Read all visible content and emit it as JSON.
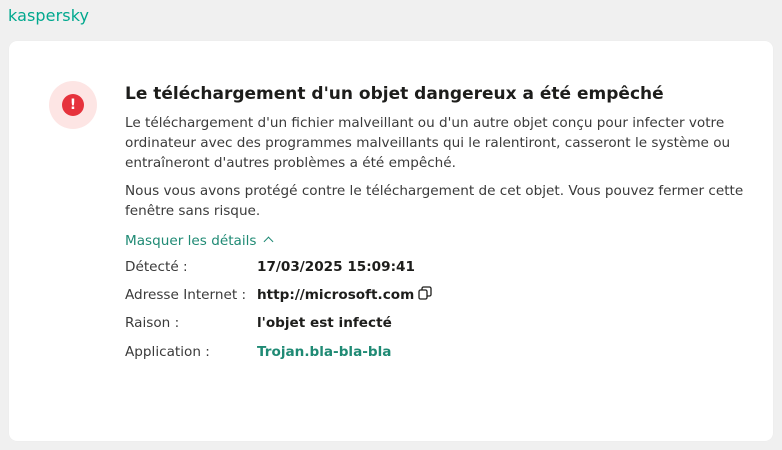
{
  "brand": {
    "logo_text": "kaspersky",
    "accent_color": "#00a88e",
    "link_color": "#1f8a74",
    "alert_color": "#e6323c"
  },
  "notification": {
    "icon": "exclamation-alert-icon",
    "icon_glyph": "!",
    "title": "Le téléchargement d'un objet dangereux a été empêché",
    "paragraph1": "Le téléchargement d'un fichier malveillant ou d'un autre objet conçu pour infecter votre ordinateur avec des programmes malveillants qui le ralentiront, casseront le système ou entraîneront d'autres problèmes a été empêché.",
    "paragraph2": "Nous vous avons protégé contre le téléchargement de cet objet. Vous pouvez fermer cette fenêtre sans risque.",
    "toggle_label": "Masquer les détails",
    "details": [
      {
        "label": "Détecté :",
        "value": "17/03/2025 15:09:41"
      },
      {
        "label": "Adresse Internet :",
        "value": "http://microsoft.com",
        "action_icon": "copy-icon"
      },
      {
        "label": "Raison :",
        "value": "l'objet est infecté"
      },
      {
        "label": "Application :",
        "value": "Trojan.bla-bla-bla"
      }
    ]
  }
}
